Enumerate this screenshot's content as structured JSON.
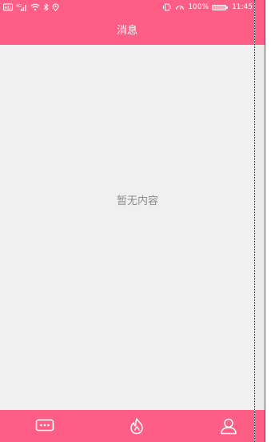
{
  "status_bar": {
    "left_icons": [
      "hd-icon",
      "signal-icon",
      "wifi-icon",
      "bluetooth-icon",
      "location-icon"
    ],
    "hd_label": "HD",
    "network_label": "4G",
    "battery_percent": "100%",
    "time": "11:45"
  },
  "header": {
    "title": "消息"
  },
  "main": {
    "empty_text": "暂无内容"
  },
  "tabbar": {
    "tabs": [
      {
        "icon": "chat-icon"
      },
      {
        "icon": "flame-icon"
      },
      {
        "icon": "user-icon"
      }
    ]
  },
  "colors": {
    "accent": "#fe5d86",
    "background": "#f0f0f0",
    "empty_text": "#8a8a8a"
  }
}
